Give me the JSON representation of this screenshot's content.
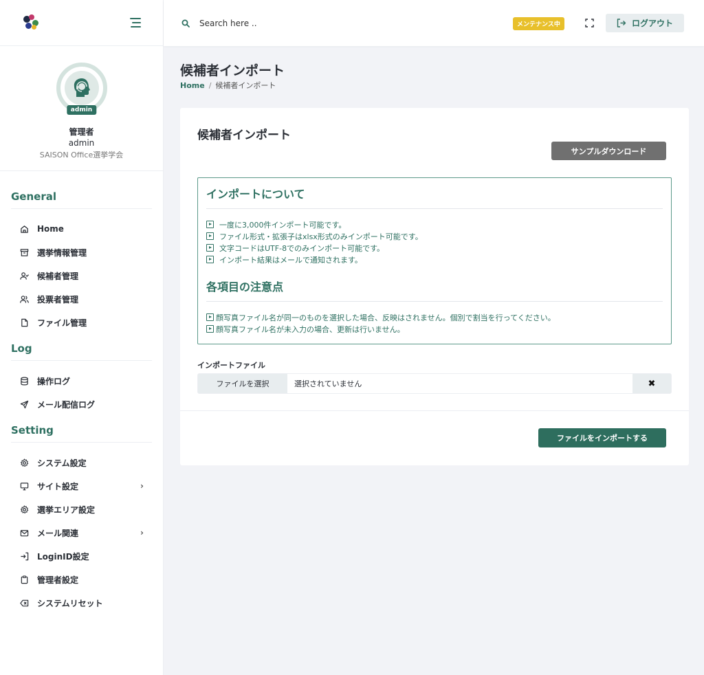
{
  "sidebar": {
    "profile": {
      "badge": "admin",
      "role": "管理者",
      "username": "admin",
      "org": "SAISON Office選挙学会"
    },
    "sections": [
      {
        "heading": "General",
        "items": [
          {
            "label": "Home",
            "icon": "home-icon"
          },
          {
            "label": "選挙情報管理",
            "icon": "archive-icon"
          },
          {
            "label": "候補者管理",
            "icon": "user-check-icon"
          },
          {
            "label": "投票者管理",
            "icon": "users-icon"
          },
          {
            "label": "ファイル管理",
            "icon": "file-icon"
          }
        ]
      },
      {
        "heading": "Log",
        "items": [
          {
            "label": "操作ログ",
            "icon": "database-icon"
          },
          {
            "label": "メール配信ログ",
            "icon": "send-icon"
          }
        ]
      },
      {
        "heading": "Setting",
        "items": [
          {
            "label": "システム設定",
            "icon": "gear-icon"
          },
          {
            "label": "サイト設定",
            "icon": "monitor-icon",
            "has_submenu": true
          },
          {
            "label": "選挙エリア設定",
            "icon": "gear-icon"
          },
          {
            "label": "メール関連",
            "icon": "mail-icon",
            "has_submenu": true
          },
          {
            "label": "LoginID設定",
            "icon": "login-icon"
          },
          {
            "label": "管理者設定",
            "icon": "clipboard-icon"
          },
          {
            "label": "システムリセット",
            "icon": "backspace-icon"
          }
        ]
      }
    ]
  },
  "topbar": {
    "search_placeholder": "Search here ..",
    "maintenance_badge": "メンテナンス中",
    "logout_label": "ログアウト"
  },
  "page": {
    "title": "候補者インポート",
    "breadcrumb": {
      "home": "Home",
      "sep": "/",
      "current": "候補者インポート"
    }
  },
  "card": {
    "title": "候補者インポート",
    "sample_download_label": "サンプルダウンロード",
    "about_heading": "インポートについて",
    "about_items": [
      "一度に3,000件インポート可能です。",
      "ファイル形式・拡張子はxlsx形式のみインポート可能です。",
      "文字コードはUTF-8でのみインポート可能です。",
      "インポート結果はメールで通知されます。"
    ],
    "notes_heading": "各項目の注意点",
    "notes_items": [
      "顔写真ファイル名が同一のものを選択した場合、反映はされません。個別で割当を行ってください。",
      "顔写真ファイル名が未入力の場合、更新は行いません。"
    ],
    "file_label": "インポートファイル",
    "file_choose_label": "ファイルを選択",
    "file_name": "選択されていません",
    "file_clear": "✖",
    "import_button_label": "ファイルをインポートする"
  },
  "colors": {
    "brand": "#2e7061",
    "maintenance": "#e8c02b",
    "sample_button": "#707070"
  }
}
